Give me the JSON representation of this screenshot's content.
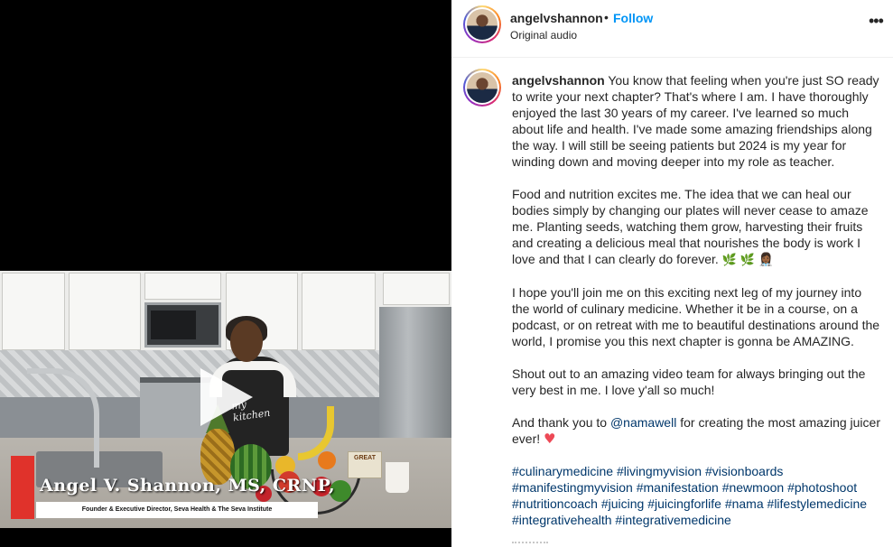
{
  "video": {
    "lower_third_name": "Angel V. Shannon, MS, CRNP,",
    "lower_third_title": "Founder & Executive Director, Seva Health & The Seva Institute",
    "apron_text": "my kitchen",
    "book_text": "GREAT"
  },
  "header": {
    "username": "angelvshannon",
    "separator": "•",
    "follow_label": "Follow",
    "audio_label": "Original audio",
    "more_label": "•••"
  },
  "caption": {
    "username": "angelvshannon",
    "p1": "You know that feeling when you're just SO ready to write your next chapter? That's where I am. I have thoroughly enjoyed the last 30 years of my career. I've learned so much about life and health. I've made some amazing friendships along the way. I will still be seeing patients but 2024 is my year for winding down and moving deeper into my role as teacher.",
    "p2": "Food and nutrition excites me. The idea that we can heal our bodies simply by changing our plates will never cease to amaze me. Planting seeds, watching them grow, harvesting their fruits and creating a delicious meal that nourishes the body is work I love and that I can clearly do forever.",
    "p2_emoji_leaf": "🌿",
    "p2_emoji_person": "👩🏾‍⚕️",
    "p3": "I hope you'll join me on this exciting next leg of my journey into the world of culinary medicine. Whether it be in a course, on a podcast, or on retreat with me to beautiful destinations around the world, I promise you this next chapter is gonna be AMAZING.",
    "p4": "Shout out to an amazing video team for always bringing out the very best in me. I love y'all so much!",
    "p5_before": "And thank you to",
    "p5_mention": "@namawell",
    "p5_after": "for creating the most amazing juicer ever!",
    "p5_heart": "♥",
    "hashtags": [
      "#culinarymedicine",
      "#livingmyvision",
      "#visionboards",
      "#manifestingmyvision",
      "#manifestation",
      "#newmoon",
      "#photoshoot",
      "#nutritioncoach",
      "#juicing",
      "#juicingforlife",
      "#nama",
      "#lifestylemedicine",
      "#integrativehealth",
      "#integrativemedicine"
    ]
  },
  "colors": {
    "follow": "#0095f6",
    "link": "#00376b",
    "heart": "#ed4956",
    "lower_third_red": "#e0322b"
  }
}
